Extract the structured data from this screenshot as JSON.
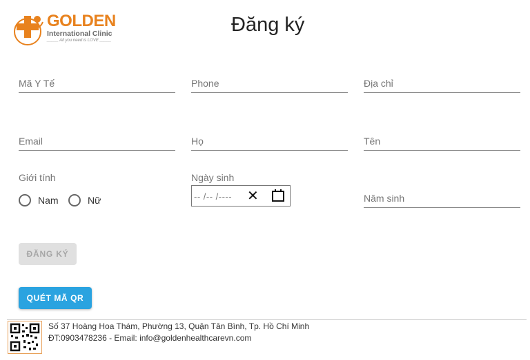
{
  "logo": {
    "name": "GOLDEN",
    "subtitle": "International Clinic",
    "tagline": "_____ All you need is LOVE _____",
    "icon": "medical-cross-logo"
  },
  "page": {
    "title": "Đăng ký"
  },
  "form": {
    "ma_y_te": "Mã Y Tế",
    "phone": "Phone",
    "dia_chi": "Địa chỉ",
    "email": "Email",
    "ho": "Họ",
    "ten": "Tên",
    "gender_label": "Giới tính",
    "gender_male": "Nam",
    "gender_female": "Nữ",
    "dob_label": "Ngày sinh",
    "dob_placeholder": "-- /-- /----",
    "nam_sinh": "Năm sinh"
  },
  "buttons": {
    "register": "ĐĂNG KÝ",
    "scan_qr": "QUÉT MÃ QR"
  },
  "footer": {
    "address": "Số 37 Hoàng Hoa Thám, Phường 13, Quận Tân Bình, Tp. Hồ Chí Minh",
    "contact": "ĐT:0903478236 - Email: info@goldenhealthcarevn.com"
  },
  "colors": {
    "brand_orange": "#e8821e",
    "primary_button": "#2aa3e0",
    "disabled_button": "#e0e0e0"
  }
}
